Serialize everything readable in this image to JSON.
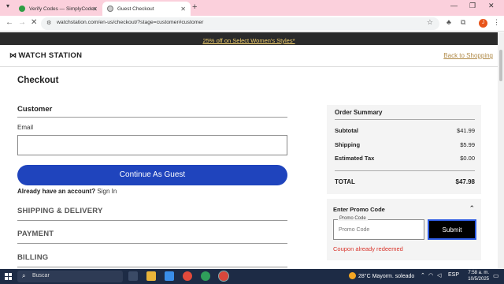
{
  "browser": {
    "tabs": [
      {
        "label": "Verify Codes — SimplyCodes",
        "icon": "simplycodes-icon",
        "color": "#2e9e44"
      },
      {
        "label": "Guest Checkout",
        "icon": "watchstation-icon",
        "color": "#555555"
      }
    ],
    "new_tab": "+",
    "url": "watchstation.com/en-us/checkout/?stage=customer#customer",
    "profile_initial": "J"
  },
  "promo_banner": "25% off on Select Women's Styles*",
  "site": {
    "logo": "WATCH STATION",
    "logo_mark": "⋈",
    "back_link": "Back to Shopping"
  },
  "checkout": {
    "title": "Checkout",
    "customer_heading": "Customer",
    "email_label": "Email",
    "email_value": "",
    "guest_button": "Continue As Guest",
    "already_text": "Already have an account?",
    "signin_link": "Sign In",
    "sections": [
      "SHIPPING & DELIVERY",
      "PAYMENT",
      "BILLING"
    ]
  },
  "order_summary": {
    "title": "Order Summary",
    "rows": [
      {
        "label": "Subtotal",
        "value": "$41.99"
      },
      {
        "label": "Shipping",
        "value": "$5.99"
      },
      {
        "label": "Estimated Tax",
        "value": "$0.00"
      }
    ],
    "total_label": "TOTAL",
    "total_value": "$47.98"
  },
  "promo_code": {
    "title": "Enter Promo Code",
    "field_label": "Promo Code",
    "placeholder": "Promo Code",
    "submit": "Submit",
    "error": "Coupon already redeemed"
  },
  "taskbar": {
    "search_placeholder": "Buscar",
    "weather_temp": "28°C",
    "weather_text": "Mayorm. soleado",
    "language": "ESP",
    "time": "7:58 a. m.",
    "date": "10/5/2025"
  },
  "colors": {
    "accent_blue": "#1f44bd",
    "banner_bg": "#2b2b2b",
    "banner_link": "#f5d26e",
    "error_red": "#d9342b",
    "tab_bar_pink": "#fbd0dc"
  }
}
